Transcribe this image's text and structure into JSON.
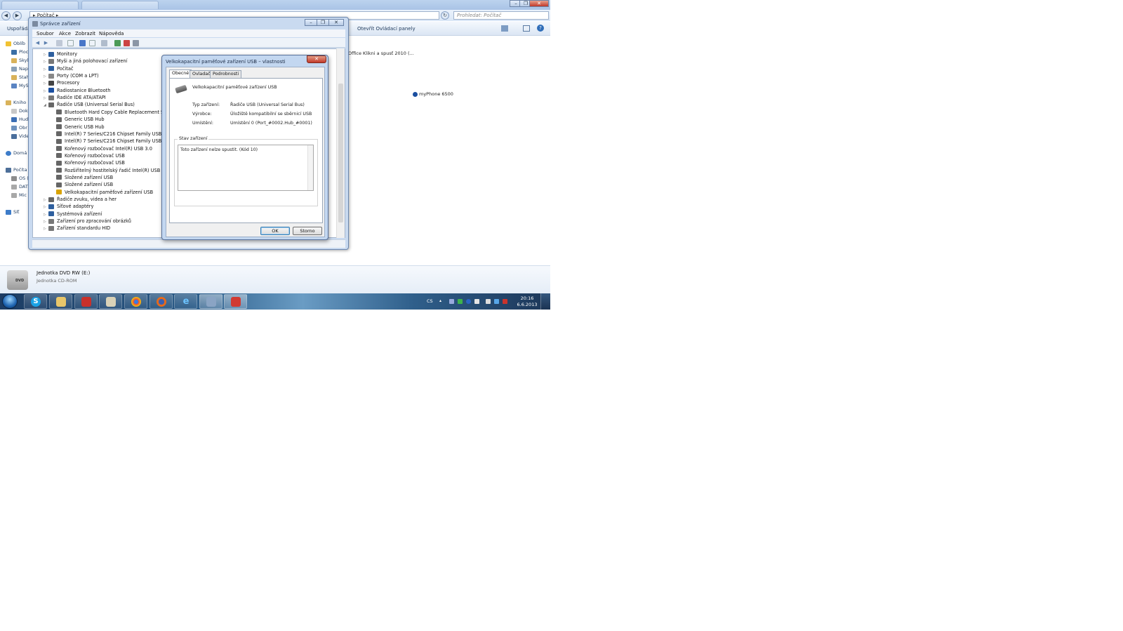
{
  "explorer": {
    "address": "▸ Počítač ▸",
    "search_placeholder": "Prohledat: Počítač",
    "toolbar": {
      "organize": "Uspořádat",
      "open_control_panel": "Otevřít Ovládací panely"
    },
    "nav": [
      "Oblíb",
      "Ploc",
      "Skyl",
      "Nap",
      "Stah",
      "MyS",
      "Kniho",
      "Dok",
      "Hud",
      "Obr",
      "Vide",
      "Domá",
      "Počíta",
      "OS (",
      "DAT",
      "Mic",
      "Síť"
    ],
    "right_items": {
      "office": "Office Klikni a spusť 2010 (...",
      "phone": "myPhone 6500"
    },
    "details": {
      "name": "Jednotka DVD RW (E:)",
      "type": "Jednotka CD-ROM"
    }
  },
  "devmgr": {
    "title": "Správce zařízení",
    "menu": [
      "Soubor",
      "Akce",
      "Zobrazit",
      "Nápověda"
    ],
    "tree": [
      {
        "label": "Monitory",
        "level": 1,
        "expander": "▷",
        "color": "#2e5f9e"
      },
      {
        "label": "Myši a jiná polohovací zařízení",
        "level": 1,
        "expander": "▷",
        "color": "#777"
      },
      {
        "label": "Počítač",
        "level": 1,
        "expander": "▷",
        "color": "#2e5f9e"
      },
      {
        "label": "Porty (COM a LPT)",
        "level": 1,
        "expander": "▷",
        "color": "#888"
      },
      {
        "label": "Procesory",
        "level": 1,
        "expander": "▷",
        "color": "#444"
      },
      {
        "label": "Radiostanice Bluetooth",
        "level": 1,
        "expander": "▷",
        "color": "#1b4fa0"
      },
      {
        "label": "Řadiče IDE ATA/ATAPI",
        "level": 1,
        "expander": "▷",
        "color": "#777"
      },
      {
        "label": "Řadiče USB (Universal Serial Bus)",
        "level": 1,
        "expander": "◢",
        "color": "#666"
      },
      {
        "label": "Bluetooth Hard Copy Cable Replacement Seri",
        "level": 2,
        "expander": "",
        "color": "#666"
      },
      {
        "label": "Generic USB Hub",
        "level": 2,
        "expander": "",
        "color": "#666"
      },
      {
        "label": "Generic USB Hub",
        "level": 2,
        "expander": "",
        "color": "#666"
      },
      {
        "label": "Intel(R) 7 Series/C216 Chipset Family USB Enh",
        "level": 2,
        "expander": "",
        "color": "#666"
      },
      {
        "label": "Intel(R) 7 Series/C216 Chipset Family USB Enh",
        "level": 2,
        "expander": "",
        "color": "#666"
      },
      {
        "label": "Kořenový rozbočovač Intel(R) USB 3.0",
        "level": 2,
        "expander": "",
        "color": "#666"
      },
      {
        "label": "Kořenový rozbočovač USB",
        "level": 2,
        "expander": "",
        "color": "#666"
      },
      {
        "label": "Kořenový rozbočovač USB",
        "level": 2,
        "expander": "",
        "color": "#666"
      },
      {
        "label": "Rozšiřitelný hostitelský řadič Intel(R) USB 3.0",
        "level": 2,
        "expander": "",
        "color": "#666"
      },
      {
        "label": "Složené zařízení USB",
        "level": 2,
        "expander": "",
        "color": "#666"
      },
      {
        "label": "Složené zařízení USB",
        "level": 2,
        "expander": "",
        "color": "#666"
      },
      {
        "label": "Velkokapacitní paměťové zařízení USB",
        "level": 2,
        "expander": "",
        "color": "#d9a300"
      },
      {
        "label": "Řadiče zvuku, videa a her",
        "level": 1,
        "expander": "▷",
        "color": "#666"
      },
      {
        "label": "Síťové adaptéry",
        "level": 1,
        "expander": "▷",
        "color": "#2e5f9e"
      },
      {
        "label": "Systémová zařízení",
        "level": 1,
        "expander": "▷",
        "color": "#2e5f9e"
      },
      {
        "label": "Zařízení pro zpracování obrázků",
        "level": 1,
        "expander": "▷",
        "color": "#777"
      },
      {
        "label": "Zařízení standardu HID",
        "level": 1,
        "expander": "▷",
        "color": "#777"
      }
    ]
  },
  "props": {
    "title": "Velkokapacitní paměťové zařízení USB – vlastnosti",
    "tabs": [
      "Obecné",
      "Ovladač",
      "Podrobnosti"
    ],
    "active_tab": "Obecné",
    "device_name": "Velkokapacitní paměťové zařízení USB",
    "fields": [
      {
        "key": "Typ zařízení:",
        "value": "Řadiče USB (Universal Serial Bus)"
      },
      {
        "key": "Výrobce:",
        "value": "Úložiště kompatibilní se sběrnicí USB"
      },
      {
        "key": "Umístění:",
        "value": "Umístění 0 (Port_#0002.Hub_#0001)"
      }
    ],
    "status_label": "Stav zařízení",
    "status_text": "Toto zařízení nelze spustit. (Kód 10)",
    "ok": "OK",
    "cancel": "Storno"
  },
  "taskbar": {
    "apps": [
      "skype",
      "explorer",
      "app-red",
      "mail",
      "chrome",
      "firefox",
      "ie",
      "device-manager",
      "pdf"
    ],
    "lang": "CS",
    "time": "20:16",
    "date": "6.6.2013"
  }
}
